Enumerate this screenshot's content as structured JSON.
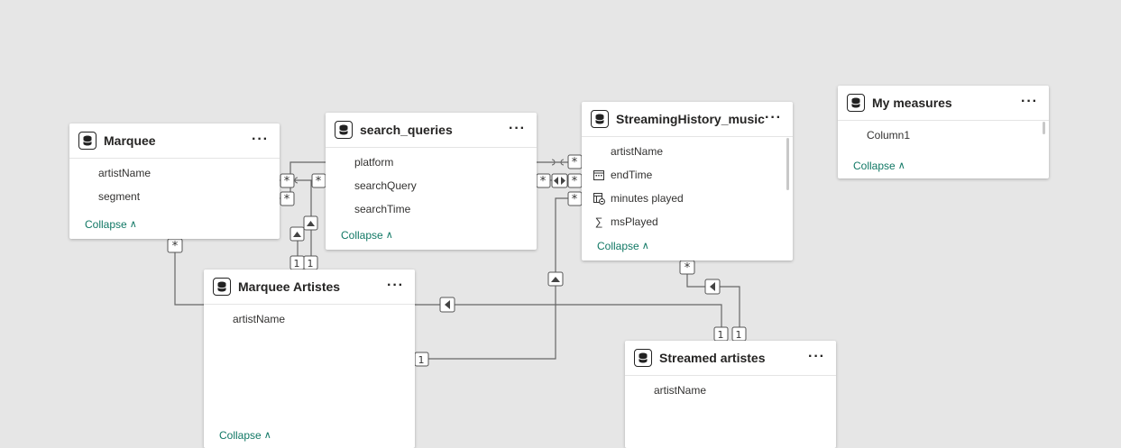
{
  "tables": {
    "marquee": {
      "title": "Marquee",
      "fields": [
        "artistName",
        "segment"
      ],
      "collapse": "Collapse"
    },
    "search_queries": {
      "title": "search_queries",
      "fields": [
        "platform",
        "searchQuery",
        "searchTime"
      ],
      "collapse": "Collapse"
    },
    "streaming_history": {
      "title": "StreamingHistory_music",
      "fields": [
        "artistName",
        "endTime",
        "minutes played",
        "msPlayed"
      ],
      "field_icons": [
        "",
        "calendar-icon",
        "calculated-column-icon",
        "sigma-icon"
      ],
      "collapse": "Collapse"
    },
    "my_measures": {
      "title": "My measures",
      "fields": [
        "Column1"
      ],
      "collapse": "Collapse"
    },
    "marquee_artistes": {
      "title": "Marquee Artistes",
      "fields": [
        "artistName"
      ],
      "collapse": "Collapse"
    },
    "streamed_artistes": {
      "title": "Streamed artistes",
      "fields": [
        "artistName"
      ]
    }
  },
  "more_label": "···",
  "cardinality": {
    "many": "*",
    "one": "1"
  }
}
